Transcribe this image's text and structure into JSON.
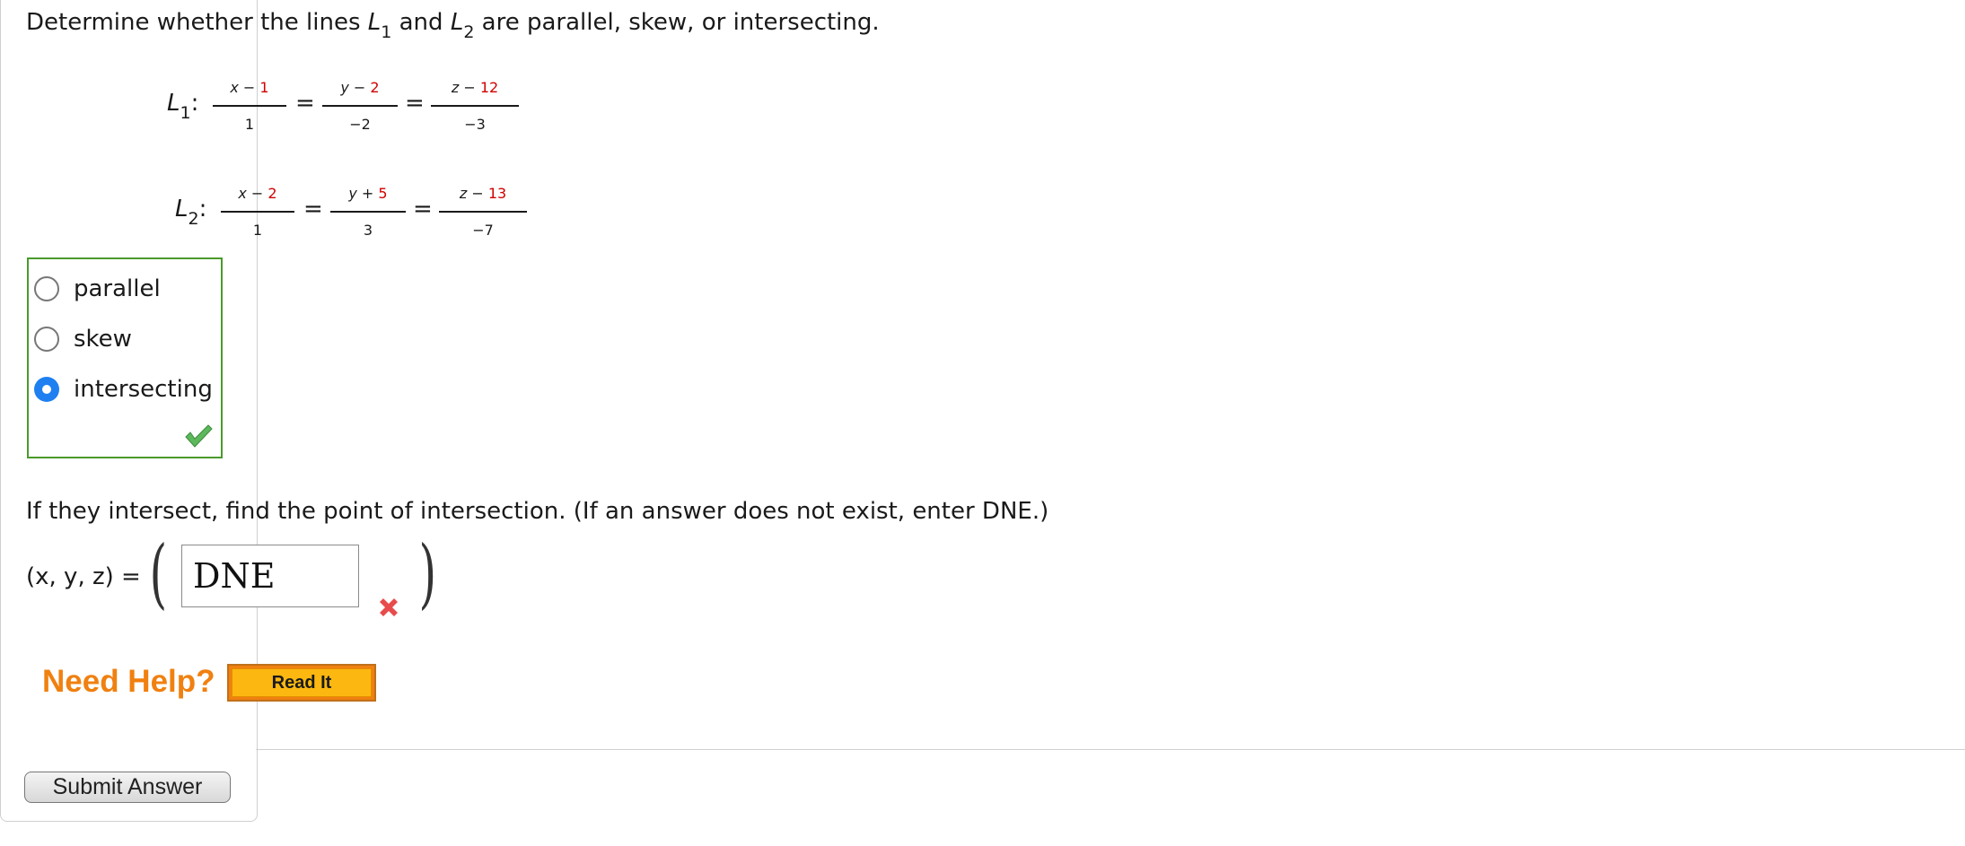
{
  "question": {
    "prefix": "Determine whether the lines ",
    "line1_letter": "L",
    "line1_sub": "1",
    "middle": " and ",
    "line2_letter": "L",
    "line2_sub": "2",
    "suffix": " are parallel, skew, or intersecting."
  },
  "line1": {
    "label": "L",
    "sub": "1",
    "colon": ":",
    "frac_x": {
      "var": "x − ",
      "const": "1",
      "den": "1"
    },
    "frac_y": {
      "var": "y − ",
      "const": "2",
      "den": "−2"
    },
    "frac_z": {
      "var": "z − ",
      "const": "12",
      "den": "−3"
    },
    "equals": "="
  },
  "line2": {
    "label": "L",
    "sub": "2",
    "colon": ":",
    "frac_x": {
      "var": "x − ",
      "const": "2",
      "den": "1"
    },
    "frac_y": {
      "var": "y + ",
      "const": "5",
      "den": "3"
    },
    "frac_z": {
      "var": "z − ",
      "const": "13",
      "den": "−7"
    },
    "equals": "="
  },
  "choices": {
    "options": [
      "parallel",
      "skew",
      "intersecting"
    ],
    "selected": "intersecting",
    "status": "correct"
  },
  "intersection": {
    "prompt": "If they intersect, find the point of intersection. (If an answer does not exist, enter DNE.)",
    "label": "(x, y, z) =",
    "open_paren": "(",
    "close_paren": ")",
    "answer_value": "DNE",
    "status": "incorrect"
  },
  "help": {
    "need_help": "Need Help?",
    "read_it": "Read It"
  },
  "submit": {
    "label": "Submit Answer"
  },
  "colors": {
    "correct_border": "#4a9a2a",
    "radio_selected": "#1e7ff0",
    "constant_red": "#d00000",
    "help_orange": "#f08010",
    "read_it_yellow": "#fcb810",
    "incorrect_red": "#e84b4b"
  }
}
